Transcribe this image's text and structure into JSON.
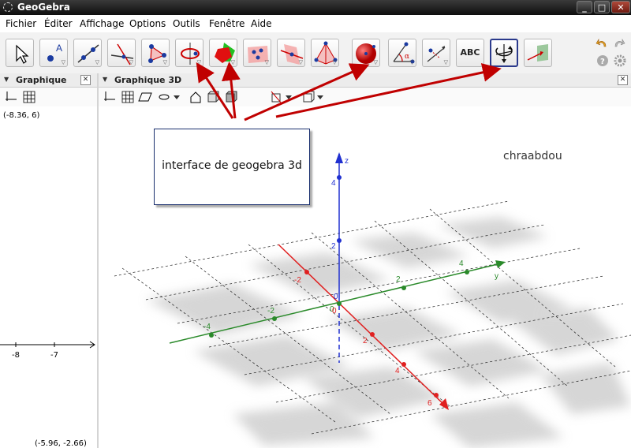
{
  "window": {
    "title": "GeoGebra",
    "minimize": "_",
    "maximize": "□",
    "close": "✕"
  },
  "menu": [
    "Fichier",
    "Éditer",
    "Affichage",
    "Options",
    "Outils",
    "Fenêtre",
    "Aide"
  ],
  "toolbar": {
    "tools": [
      {
        "name": "move-tool-icon"
      },
      {
        "name": "point-tool-icon"
      },
      {
        "name": "line-tool-icon"
      },
      {
        "name": "perpendicular-line-tool-icon"
      },
      {
        "name": "polygon-tool-icon"
      },
      {
        "name": "circle-tool-icon"
      },
      {
        "name": "intersect-surfaces-tool-icon"
      },
      {
        "name": "plane-tool-icon"
      },
      {
        "name": "perpendicular-plane-tool-icon"
      },
      {
        "name": "pyramid-tool-icon"
      },
      {
        "name": "sphere-tool-icon"
      },
      {
        "name": "angle-tool-icon"
      },
      {
        "name": "reflect-tool-icon"
      },
      {
        "name": "text-tool-icon",
        "label": "ABC"
      },
      {
        "name": "rotate-view-tool-icon",
        "selected": true
      },
      {
        "name": "view-from-front-tool-icon"
      }
    ],
    "undo_icon": "undo-icon",
    "redo_icon": "redo-icon",
    "help_icon": "help-icon",
    "settings_icon": "settings-icon"
  },
  "left_panel": {
    "title": "Graphique",
    "close": "✕",
    "corner_top": "(-8.36, 6)",
    "corner_bottom": "(-5.96, -2.66)",
    "x_ticks": [
      "-8",
      "-7"
    ]
  },
  "right_panel": {
    "title": "Graphique 3D",
    "close": "✕"
  },
  "annotation": {
    "callout_text": "interface de geogebra 3d",
    "author": "chraabdou",
    "arrow_color": "#c00000"
  },
  "axes_3d": {
    "x_axis_color": "#e02020",
    "y_axis_color": "#2a8a2a",
    "z_axis_color": "#2030d0",
    "z_label": "z",
    "y_label": "y",
    "x_ticks": [
      "-2",
      "0",
      "2",
      "4",
      "6"
    ],
    "y_ticks": [
      "-4",
      "-2",
      "0",
      "2",
      "4"
    ],
    "z_ticks": [
      "2",
      "4"
    ],
    "origin_label": "0"
  }
}
